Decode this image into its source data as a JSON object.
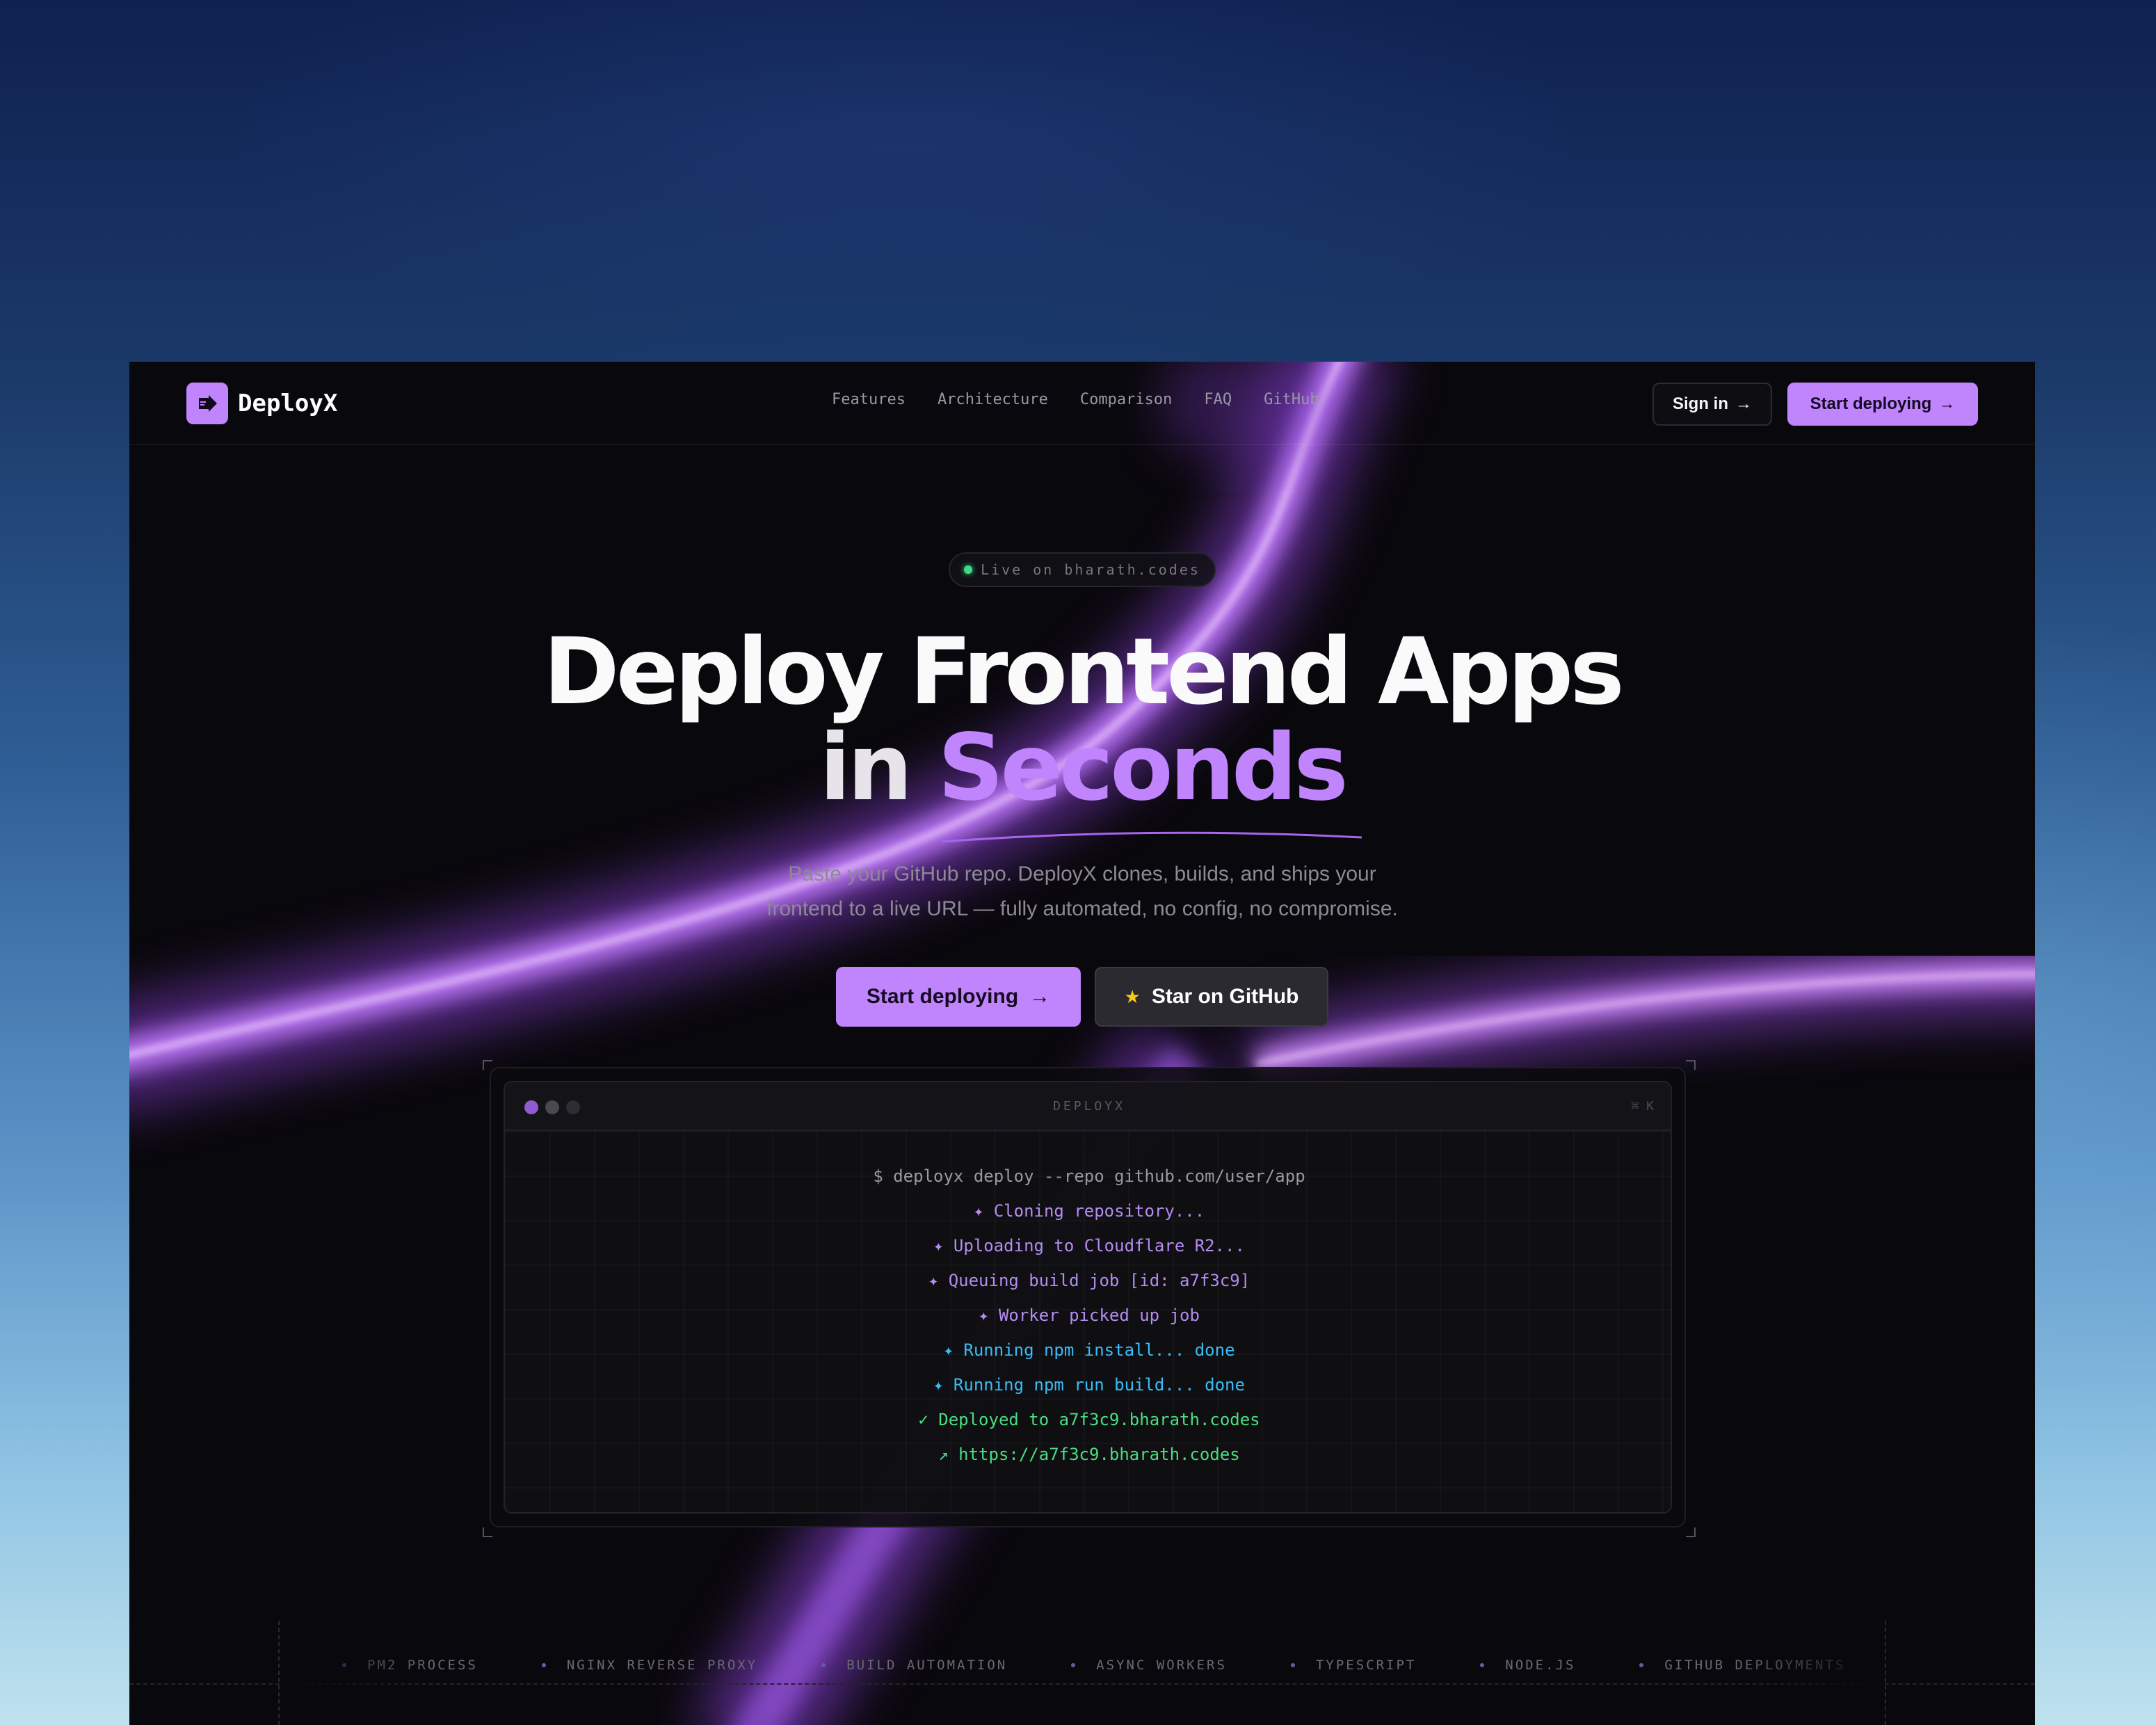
{
  "brand": {
    "name": "DeployX"
  },
  "nav": {
    "links": [
      "Features",
      "Architecture",
      "Comparison",
      "FAQ",
      "GitHub"
    ],
    "sign_in": "Sign in",
    "start": "Start deploying"
  },
  "hero": {
    "pill": "Live on bharath.codes",
    "line1": "Deploy Frontend Apps",
    "line2_plain": "in",
    "line2_accent": "Seconds",
    "subtext_1": "Paste your GitHub repo. DeployX clones, builds, and ships your",
    "subtext_2": "frontend to a live URL — fully automated, no config, no compromise.",
    "cta_primary": "Start deploying",
    "cta_secondary": "Star on GitHub"
  },
  "terminal": {
    "title": "DEPLOYX",
    "shortcut": "⌘ K",
    "lines": [
      {
        "text": "$ deployx deploy --repo github.com/user/app",
        "color": "#9a98a3"
      },
      {
        "text": "✦ Cloning repository...",
        "color": "#b58cf0"
      },
      {
        "text": "✦ Uploading to Cloudflare R2...",
        "color": "#b58cf0"
      },
      {
        "text": "✦ Queuing build job [id: a7f3c9]",
        "color": "#b58cf0"
      },
      {
        "text": "✦ Worker picked up job",
        "color": "#b58cf0"
      },
      {
        "text": "✦ Running npm install... done",
        "color": "#38bdf8"
      },
      {
        "text": "✦ Running npm run build... done",
        "color": "#38bdf8"
      },
      {
        "text": "✓ Deployed to a7f3c9.bharath.codes",
        "color": "#4ade80"
      },
      {
        "text": "↗ https://a7f3c9.bharath.codes",
        "color": "#4ade80"
      }
    ]
  },
  "ticker": {
    "items": [
      "PM2 PROCESS",
      "NGINX REVERSE PROXY",
      "BUILD AUTOMATION",
      "ASYNC WORKERS",
      "TYPESCRIPT",
      "NODE.JS",
      "GITHUB DEPLOYMENTS"
    ]
  },
  "colors": {
    "accent": "#c084fc",
    "success": "#4ade80",
    "info": "#38bdf8",
    "star": "#facc15"
  }
}
